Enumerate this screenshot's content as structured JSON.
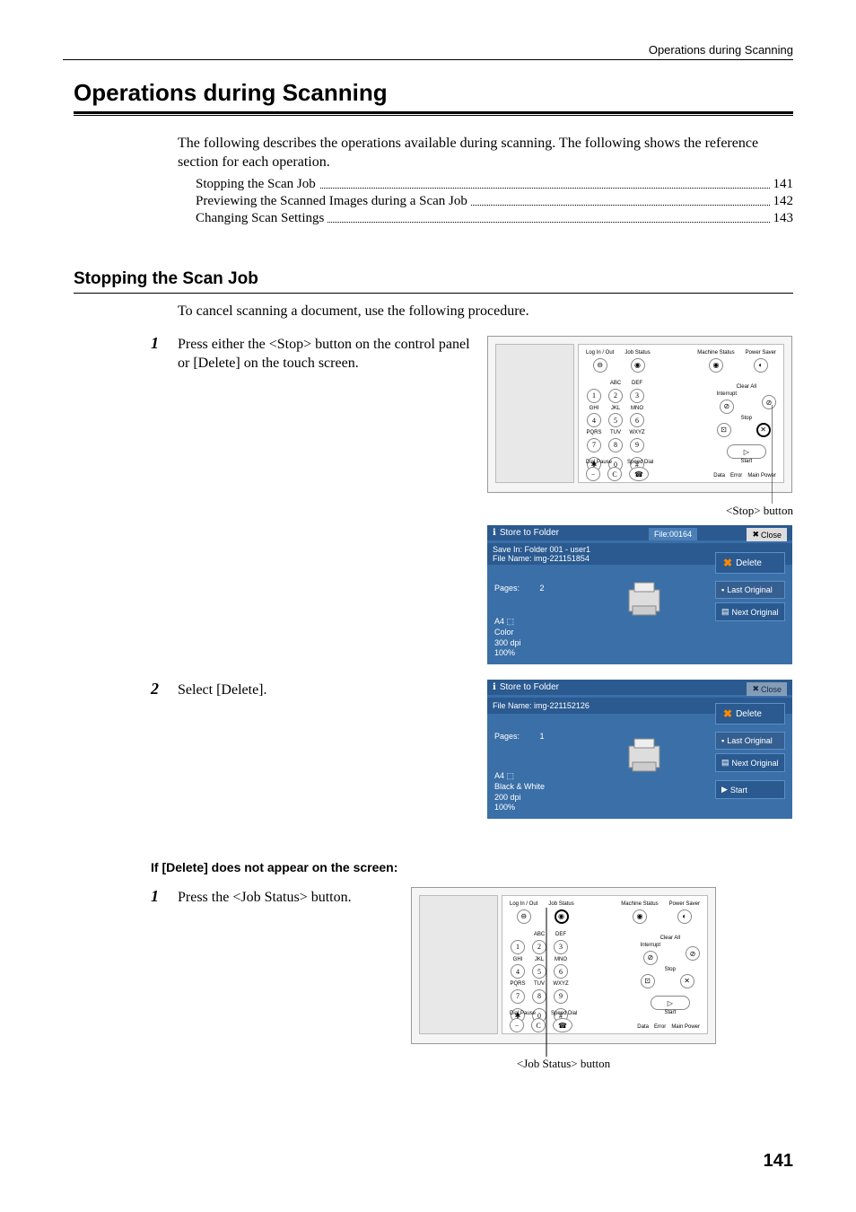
{
  "header": {
    "rightText": "Operations during Scanning"
  },
  "mainHeading": "Operations during Scanning",
  "intro": "The following describes the operations available during scanning. The following shows the reference section for each operation.",
  "toc": [
    {
      "label": "Stopping the Scan Job",
      "page": "141"
    },
    {
      "label": "Previewing the Scanned Images during a Scan Job",
      "page": "142"
    },
    {
      "label": "Changing Scan Settings",
      "page": "143"
    }
  ],
  "section1": {
    "heading": "Stopping the Scan Job",
    "intro": "To cancel scanning a document, use the following procedure.",
    "step1num": "1",
    "step1text": "Press either the <Stop> button on the control panel or [Delete] on the touch screen.",
    "step2num": "2",
    "step2text": "Select [Delete]."
  },
  "panel": {
    "labels": {
      "login": "Log In / Out",
      "jobStatus": "Job Status",
      "machineStatus": "Machine Status",
      "powerSaver": "Power Saver",
      "clearAll": "Clear All",
      "interrupt": "Interrupt",
      "stop": "Stop",
      "start": "Start",
      "dialPause": "Dial Pause",
      "speedDial": "Speed Dial",
      "data": "Data",
      "error": "Error",
      "mainPower": "Main Power"
    },
    "keys": {
      "abc": "ABC",
      "def": "DEF",
      "ghi": "GHI",
      "jkl": "JKL",
      "mno": "MNO",
      "pqrs": "PQRS",
      "tuv": "TUV",
      "wxyz": "WXYZ"
    },
    "nums": {
      "1": "1",
      "2": "2",
      "3": "3",
      "4": "4",
      "5": "5",
      "6": "6",
      "7": "7",
      "8": "8",
      "9": "9",
      "0": "0",
      "star": "✱",
      "hash": "#",
      "c": "C"
    }
  },
  "stopCallout": "<Stop> button",
  "jobStatusCallout": "<Job Status> button",
  "screen1": {
    "title": "Store to Folder",
    "fileNum": "File:00164",
    "close": "Close",
    "saveIn": "Save In: Folder 001 - user1",
    "fileName": "File Name: img-221151854",
    "pagesLabel": "Pages:",
    "pagesValue": "2",
    "info": {
      "size": "A4 ⬚",
      "color": "Color",
      "dpi": "300 dpi",
      "pct": "100%"
    },
    "delete": "Delete",
    "lastOriginal": "Last Original",
    "nextOriginal": "Next Original"
  },
  "screen2": {
    "title": "Store to Folder",
    "close": "Close",
    "fileName": "File Name: img-221152126",
    "pagesLabel": "Pages:",
    "pagesValue": "1",
    "info": {
      "size": "A4 ⬚",
      "color": "Black & White",
      "dpi": "200 dpi",
      "pct": "100%"
    },
    "delete": "Delete",
    "lastOriginal": "Last Original",
    "nextOriginal": "Next Original",
    "start": "Start"
  },
  "subsection": {
    "heading": "If [Delete] does not appear on the screen:",
    "step1num": "1",
    "step1text": "Press the <Job Status> button."
  },
  "pageNumber": "141"
}
